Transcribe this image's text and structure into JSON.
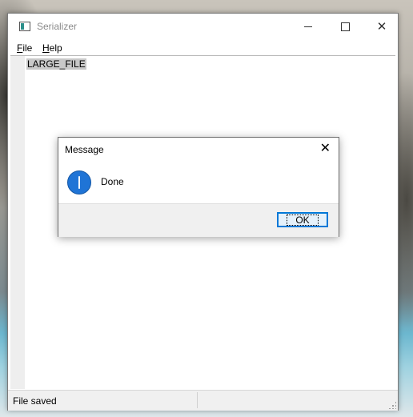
{
  "window": {
    "title": "Serializer",
    "controls": {
      "minimize": "minimize-icon",
      "maximize": "maximize-icon",
      "close": "close-icon"
    }
  },
  "menu": [
    {
      "label_first": "F",
      "label_rest": "ile"
    },
    {
      "label_first": "H",
      "label_rest": "elp"
    }
  ],
  "editor": {
    "lines": [
      "LARGE_FILE"
    ]
  },
  "status": {
    "text": "File saved"
  },
  "dialog": {
    "title": "Message",
    "icon": "info-icon",
    "message": "Done",
    "ok_label": "OK",
    "accent_color": "#0078d7"
  }
}
